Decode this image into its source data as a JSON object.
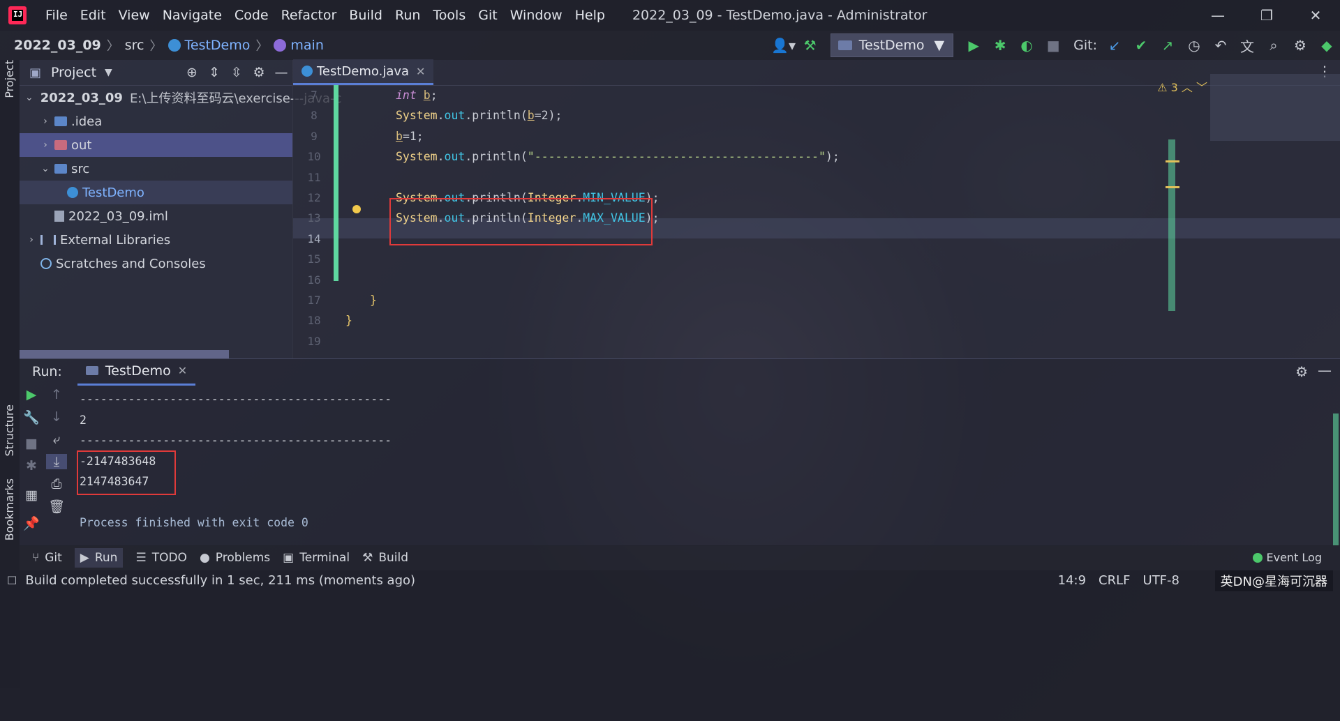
{
  "window": {
    "title": "2022_03_09 - TestDemo.java - Administrator",
    "logo_text": "IJ",
    "menu": [
      "File",
      "Edit",
      "View",
      "Navigate",
      "Code",
      "Refactor",
      "Build",
      "Run",
      "Tools",
      "Git",
      "Window",
      "Help"
    ],
    "minimize": "—",
    "restore": "❐",
    "close": "✕"
  },
  "breadcrumb": {
    "project": "2022_03_09",
    "folder": "src",
    "class": "TestDemo",
    "method": "main"
  },
  "toolbar": {
    "run_config": "TestDemo",
    "git_label": "Git:"
  },
  "left_strip": {
    "project_tab": "Project",
    "structure_tab": "Structure",
    "bookmarks_tab": "Bookmarks"
  },
  "project_panel": {
    "title": "Project",
    "tree": [
      {
        "name": "2022_03_09",
        "path": "E:\\上传资料至码云\\exercise---java-c"
      },
      {
        "name": ".idea"
      },
      {
        "name": "out"
      },
      {
        "name": "src"
      },
      {
        "name": "TestDemo"
      },
      {
        "name": "2022_03_09.iml"
      },
      {
        "name": "External Libraries"
      },
      {
        "name": "Scratches and Consoles"
      }
    ]
  },
  "editor": {
    "tab_label": "TestDemo.java",
    "warning_count": "3",
    "line_numbers": [
      "7",
      "8",
      "9",
      "10",
      "11",
      "12",
      "13",
      "14",
      "15",
      "16",
      "17",
      "18",
      "19"
    ],
    "active_line": "14",
    "code": {
      "l7_kw": "int",
      "l7_var": "b",
      "l7_end": ";",
      "sys": "System",
      "out": "out",
      "println": ".println(",
      "l8_var": "b",
      "l8_rest": "=2);",
      "l9_var": "b",
      "l9_rest": "=1;",
      "l10_str": "\"-----------------------------------------\"",
      "l10_end": ");",
      "integer": "Integer",
      "min_value": "MIN_VALUE",
      "max_value": "MAX_VALUE",
      "close": ");",
      "brace": "}"
    }
  },
  "run_panel": {
    "label": "Run:",
    "tab": "TestDemo",
    "output": [
      "---------------------------------------------",
      "2",
      "---------------------------------------------",
      "-2147483648",
      "2147483647",
      "",
      "Process finished with exit code 0"
    ]
  },
  "bottom_tabs": [
    "Git",
    "Run",
    "TODO",
    "Problems",
    "Terminal",
    "Build"
  ],
  "event_log": "Event Log",
  "status": {
    "message": "Build completed successfully in 1 sec, 211 ms (moments ago)",
    "position": "14:9",
    "line_sep": "CRLF",
    "encoding": "UTF-8",
    "watermark": "英DN@星海可沉器"
  }
}
